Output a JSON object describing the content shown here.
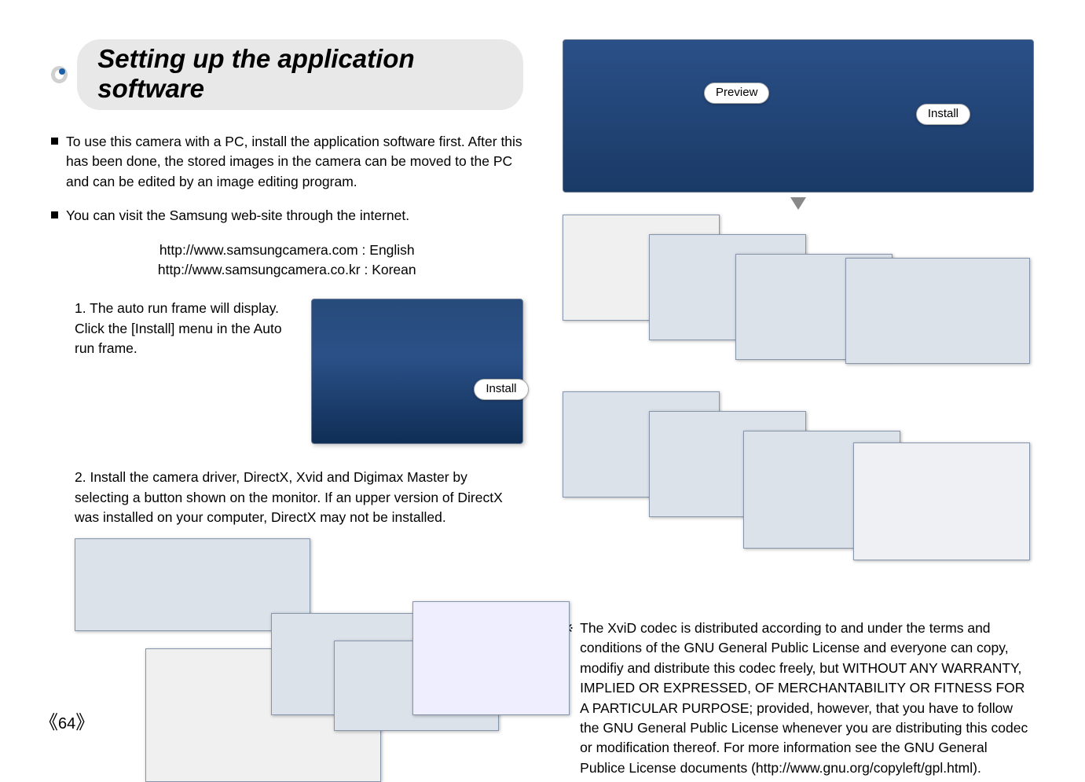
{
  "title": "Setting up the application software",
  "left": {
    "para1": "To use this camera with a PC, install the application software first. After this has been done, the stored images in the camera can be moved to the PC and can be edited by an image editing program.",
    "para2": "You can visit the Samsung web-site through the internet.",
    "link_en": "http://www.samsungcamera.com : English",
    "link_kr": "http://www.samsungcamera.co.kr : Korean",
    "step1": "1. The auto run frame will display. Click the [Install] menu in the Auto run frame.",
    "install_label": "Install",
    "step2": "2. Install the camera driver, DirectX, Xvid and Digimax Master by selecting a button shown on the monitor. If an upper version of DirectX was installed on your computer, DirectX may not be installed."
  },
  "right": {
    "preview_label": "Preview",
    "install_label": "Install",
    "footnote_mark": "※",
    "footnote": "The XviD codec is distributed according to and under the terms and conditions of the GNU General Public License and everyone can copy, modifiy and distribute this codec freely, but WITHOUT ANY WARRANTY, IMPLIED OR EXPRESSED, OF MERCHANTABILITY OR FITNESS FOR A PARTICULAR PURPOSE; provided, however, that you have to follow the GNU General Public License whenever you are distributing this codec or modification thereof. For more information see the GNU General Publice License documents (http://www.gnu.org/copyleft/gpl.html)."
  },
  "page_number": "64"
}
